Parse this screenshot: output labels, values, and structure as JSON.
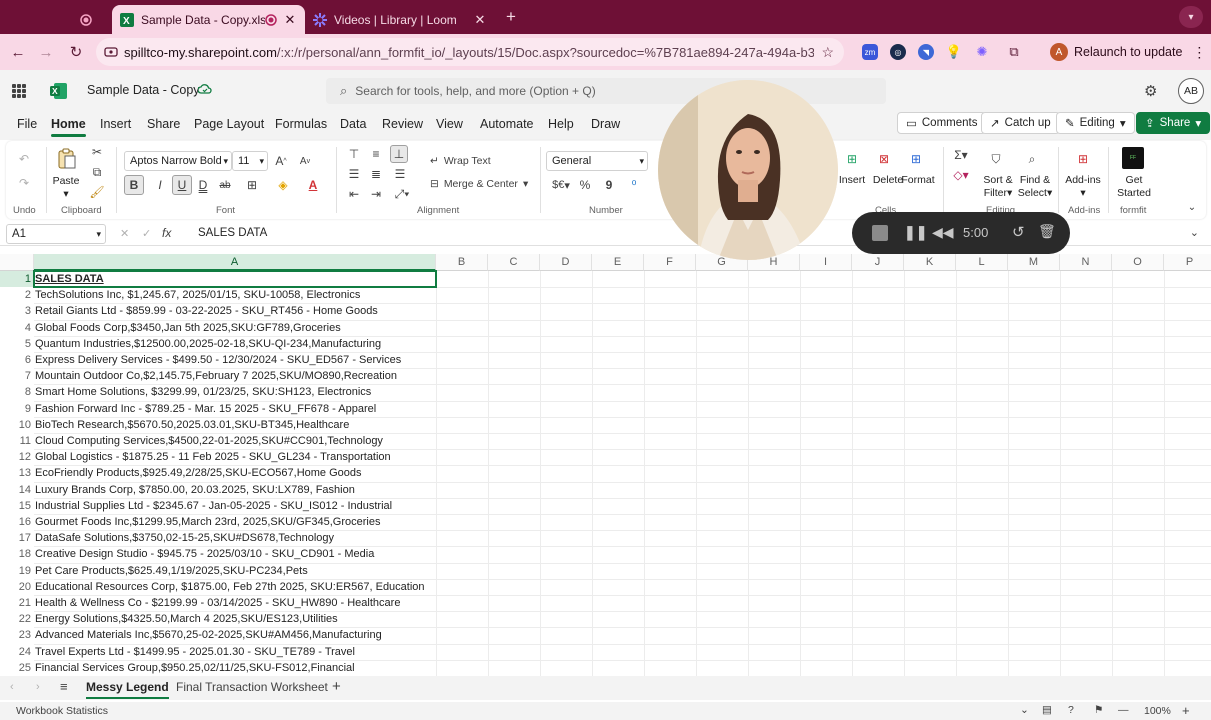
{
  "browser": {
    "tabs": [
      {
        "label": "",
        "icon": "record-icon"
      },
      {
        "label": "Sample Data - Copy.xlsx",
        "icon": "excel-icon"
      },
      {
        "label": "Videos | Library | Loom",
        "icon": "loom-icon"
      }
    ],
    "url_host": "spilltco-my.sharepoint.com",
    "url_path": "/:x:/r/personal/ann_formfit_io/_layouts/15/Doc.aspx?sourcedoc=%7B781ae894-247a-494a-b3a7-...",
    "relaunch_label": "Relaunch to update",
    "profile_initial": "A"
  },
  "app": {
    "doc_title": "Sample Data - Copy",
    "search_placeholder": "Search for tools, help, and more (Option + Q)",
    "user_initials": "AB"
  },
  "ribbon_tabs": [
    "File",
    "Home",
    "Insert",
    "Share",
    "Page Layout",
    "Formulas",
    "Data",
    "Review",
    "View",
    "Automate",
    "Help",
    "Draw"
  ],
  "header_buttons": {
    "comments": "Comments",
    "catchup": "Catch up",
    "editing": "Editing",
    "share": "Share"
  },
  "ribbon": {
    "undo_label": "Undo",
    "paste_label": "Paste",
    "clipboard_label": "Clipboard",
    "font_name": "Aptos Narrow Bold",
    "font_size": "11",
    "font_label": "Font",
    "wrap_text": "Wrap Text",
    "merge_center": "Merge & Center",
    "alignment_label": "Alignment",
    "number_format": "General",
    "number_label": "Number",
    "number_currency": "$€",
    "number_percent": "%",
    "number_comma": "9",
    "insert": "Insert",
    "delete": "Delete",
    "format": "Format",
    "cells_label": "Cells",
    "sort_filter_1": "Sort &",
    "sort_filter_2": "Filter",
    "find_select_1": "Find &",
    "find_select_2": "Select",
    "editing_label": "Editing",
    "addins": "Add-ins",
    "addins_label": "Add-ins",
    "get_started_1": "Get",
    "get_started_2": "Started",
    "formfit_label": "formfit"
  },
  "formula_bar": {
    "name_box": "A1",
    "fx": "fx",
    "value": "SALES DATA"
  },
  "columns": [
    "A",
    "B",
    "C",
    "D",
    "E",
    "F",
    "G",
    "H",
    "I",
    "J",
    "K",
    "L",
    "M",
    "N",
    "O",
    "P"
  ],
  "rows": [
    {
      "n": "1",
      "a": "SALES DATA"
    },
    {
      "n": "2",
      "a": "TechSolutions Inc, $1,245.67, 2025/01/15, SKU-10058, Electronics"
    },
    {
      "n": "3",
      "a": "Retail Giants Ltd - $859.99 - 03-22-2025 - SKU_RT456 - Home Goods"
    },
    {
      "n": "4",
      "a": "Global Foods Corp,$3450,Jan 5th 2025,SKU:GF789,Groceries"
    },
    {
      "n": "5",
      "a": "Quantum Industries,$12500.00,2025-02-18,SKU-QI-234,Manufacturing"
    },
    {
      "n": "6",
      "a": "Express Delivery Services - $499.50 - 12/30/2024 - SKU_ED567 - Services"
    },
    {
      "n": "7",
      "a": "Mountain Outdoor Co,$2,145.75,February 7 2025,SKU/MO890,Recreation"
    },
    {
      "n": "8",
      "a": "Smart Home Solutions, $3299.99, 01/23/25, SKU:SH123, Electronics"
    },
    {
      "n": "9",
      "a": "Fashion Forward Inc - $789.25 - Mar. 15 2025 - SKU_FF678 - Apparel"
    },
    {
      "n": "10",
      "a": "BioTech Research,$5670.50,2025.03.01,SKU-BT345,Healthcare"
    },
    {
      "n": "11",
      "a": "Cloud Computing Services,$4500,22-01-2025,SKU#CC901,Technology"
    },
    {
      "n": "12",
      "a": "Global Logistics - $1875.25 - 11 Feb 2025 - SKU_GL234 - Transportation"
    },
    {
      "n": "13",
      "a": "EcoFriendly Products,$925.49,2/28/25,SKU-ECO567,Home Goods"
    },
    {
      "n": "14",
      "a": "Luxury Brands Corp, $7850.00, 20.03.2025, SKU:LX789, Fashion"
    },
    {
      "n": "15",
      "a": "Industrial Supplies Ltd - $2345.67 - Jan-05-2025 - SKU_IS012 - Industrial"
    },
    {
      "n": "16",
      "a": "Gourmet Foods Inc,$1299.95,March 23rd, 2025,SKU/GF345,Groceries"
    },
    {
      "n": "17",
      "a": "DataSafe Solutions,$3750,02-15-25,SKU#DS678,Technology"
    },
    {
      "n": "18",
      "a": "Creative Design Studio - $945.75 - 2025/03/10 - SKU_CD901 - Media"
    },
    {
      "n": "19",
      "a": "Pet Care Products,$625.49,1/19/2025,SKU-PC234,Pets"
    },
    {
      "n": "20",
      "a": "Educational Resources Corp, $1875.00, Feb 27th 2025, SKU:ER567, Education"
    },
    {
      "n": "21",
      "a": "Health & Wellness Co - $2199.99 - 03/14/2025 - SKU_HW890 - Healthcare"
    },
    {
      "n": "22",
      "a": "Energy Solutions,$4325.50,March 4 2025,SKU/ES123,Utilities"
    },
    {
      "n": "23",
      "a": "Advanced Materials Inc,$5670,25-02-2025,SKU#AM456,Manufacturing"
    },
    {
      "n": "24",
      "a": "Travel Experts Ltd - $1499.95 - 2025.01.30 - SKU_TE789 - Travel"
    },
    {
      "n": "25",
      "a": "Financial Services Group,$950.25,02/11/25,SKU-FS012,Financial"
    }
  ],
  "sheets": {
    "active": "Messy Legend",
    "other": "Final Transaction Worksheet"
  },
  "status": {
    "left": "Workbook Statistics",
    "zoom": "100%"
  },
  "loom": {
    "timer": "5:00"
  },
  "colors": {
    "excel_green": "#107c41",
    "chrome_tabbar": "#6e1036",
    "chrome_toolbar": "#f9d8e6",
    "loom_bar": "#2a2a2a"
  }
}
